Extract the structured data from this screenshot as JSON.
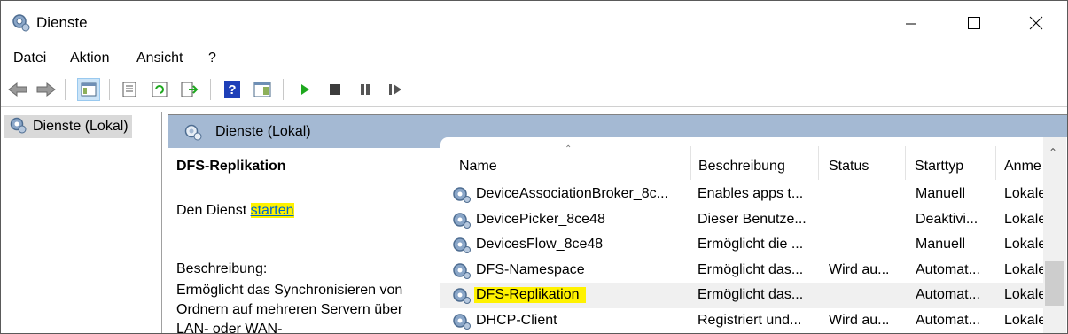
{
  "window": {
    "title": "Dienste"
  },
  "menu": [
    "Datei",
    "Aktion",
    "Ansicht",
    "?"
  ],
  "toolbar": {
    "icons": [
      "back-icon",
      "forward-icon",
      "show-hide-tree-icon",
      "properties-icon",
      "refresh-icon",
      "export-list-icon",
      "help-icon",
      "show-hide-action-pane-icon",
      "start-service-icon",
      "stop-service-icon",
      "pause-service-icon",
      "resume-service-icon"
    ],
    "colors": {
      "play": "#1ea81e",
      "stop": "#3c3c3c",
      "help": "#1e3fb8"
    }
  },
  "tree": {
    "root_label": "Dienste (Lokal)"
  },
  "panel": {
    "header": "Dienste (Lokal)"
  },
  "details": {
    "service_name": "DFS-Replikation",
    "action_prefix": "Den Dienst",
    "action_link": "starten",
    "description_label": "Beschreibung:",
    "description_text": "Ermöglicht das Synchronisieren von Ordnern auf mehreren Servern über LAN- oder WAN-"
  },
  "list": {
    "columns": [
      "Name",
      "Beschreibung",
      "Status",
      "Starttyp",
      "Anme"
    ],
    "rows": [
      {
        "name": "DeviceAssociationBroker_8c...",
        "description": "Enables apps t...",
        "status": "",
        "starttype": "Manuell",
        "logon": "Lokale"
      },
      {
        "name": "DevicePicker_8ce48",
        "description": "Dieser Benutze...",
        "status": "",
        "starttype": "Deaktivi...",
        "logon": "Lokale"
      },
      {
        "name": "DevicesFlow_8ce48",
        "description": "Ermöglicht die ...",
        "status": "",
        "starttype": "Manuell",
        "logon": "Lokale"
      },
      {
        "name": "DFS-Namespace",
        "description": "Ermöglicht das...",
        "status": "Wird au...",
        "starttype": "Automat...",
        "logon": "Lokale"
      },
      {
        "name": "DFS-Replikation",
        "description": "Ermöglicht das...",
        "status": "",
        "starttype": "Automat...",
        "logon": "Lokale"
      },
      {
        "name": "DHCP-Client",
        "description": "Registriert und...",
        "status": "Wird au...",
        "starttype": "Automat...",
        "logon": "Lokale"
      }
    ],
    "selected_index": 4,
    "highlight_color": "#fff200"
  }
}
